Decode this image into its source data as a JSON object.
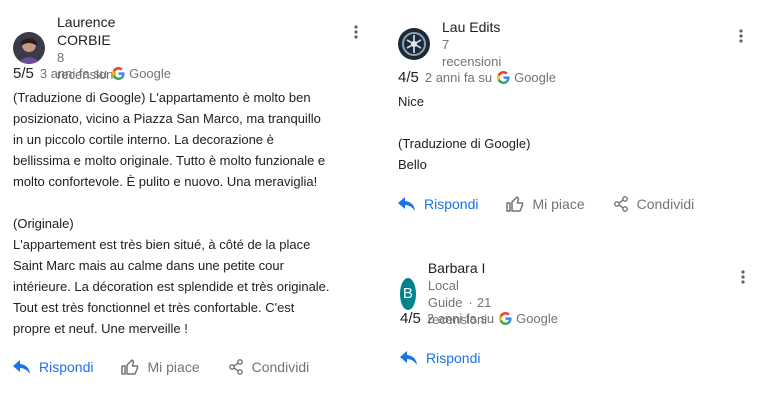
{
  "reviews": [
    {
      "name": "Laurence CORBIE",
      "count": "8 recensioni",
      "score": "5/5",
      "when": "3 anni fa su",
      "source": "Google",
      "text": "(Traduzione di Google) L'appartamento è molto ben\nposizionato, vicino a Piazza San Marco, ma tranquillo\nin un piccolo cortile interno. La decorazione è\nbellissima e molto originale. Tutto è molto funzionale e\nmolto confortevole. È pulito e nuovo. Una meraviglia!\n\n(Originale)\nL'appartement est très bien situé, à côté de la place\nSaint Marc mais au calme dans une petite cour\nintérieure. La décoration est splendide et très originale.\nTout est très fonctionnel et très confortable. C'est\npropre et neuf. Une merveille !",
      "actions": {
        "reply": "Rispondi",
        "like": "Mi piace",
        "share": "Condividi"
      }
    },
    {
      "name": "Lau Edits",
      "count": "7 recensioni",
      "score": "4/5",
      "when": "2 anni fa su",
      "source": "Google",
      "text": "Nice\n\n(Traduzione di Google)\nBello",
      "actions": {
        "reply": "Rispondi",
        "like": "Mi piace",
        "share": "Condividi"
      }
    },
    {
      "name": "Barbara I",
      "initial": "B",
      "guide": "Local Guide",
      "count": "21 recensioni",
      "score": "4/5",
      "when": "2 anni fa su",
      "source": "Google",
      "actions": {
        "reply": "Rispondi"
      }
    }
  ],
  "colors": {
    "blue": "#1a73e8",
    "grey": "#70757a",
    "avatar_b": "#00838f"
  }
}
